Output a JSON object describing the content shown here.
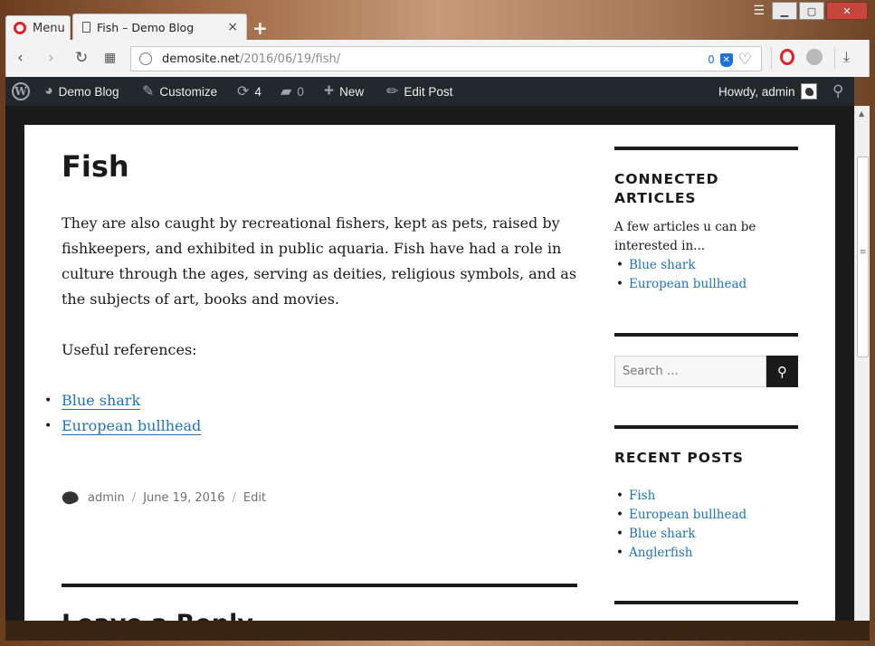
{
  "browser": {
    "menu_label": "Menu",
    "tab_title": "Fish – Demo Blog",
    "tab_close": "×",
    "new_tab": "+",
    "url_host": "demosite.net",
    "url_path": "/2016/06/19/fish/",
    "adblock_count": "0",
    "window": {
      "minimize": "▁",
      "maximize": "▢",
      "close": "✕"
    }
  },
  "adminbar": {
    "site_name": "Demo Blog",
    "customize": "Customize",
    "updates_count": "4",
    "comments_count": "0",
    "new_label": "New",
    "edit_post": "Edit Post",
    "howdy": "Howdy, admin"
  },
  "post": {
    "title": "Fish",
    "paragraph": "They are also caught by recreational fishers, kept as pets, raised by fishkeepers, and exhibited in public aquaria. Fish have had a role in culture through the ages, serving as deities, religious symbols, and as the subjects of art, books and movies.",
    "references_label": "Useful references:",
    "references": [
      "Blue shark",
      "European bullhead"
    ],
    "author": "admin",
    "date": "June 19, 2016",
    "edit": "Edit",
    "leave_reply": "Leave a Reply"
  },
  "sidebar": {
    "connected": {
      "title": "CONNECTED ARTICLES",
      "text": "A few articles u can be interested in...",
      "links": [
        "Blue shark",
        "European bullhead"
      ]
    },
    "search": {
      "placeholder": "Search …"
    },
    "recent": {
      "title": "RECENT POSTS",
      "links": [
        "Fish",
        "European bullhead",
        "Blue shark",
        "Anglerfish"
      ]
    }
  }
}
